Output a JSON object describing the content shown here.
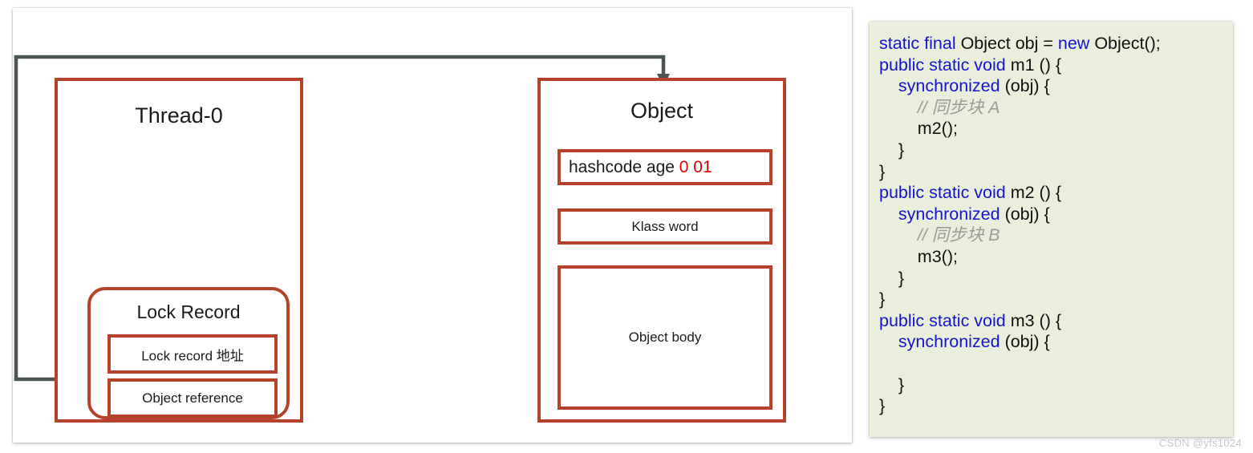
{
  "colors": {
    "brick_border": "#b5432a",
    "connector_gray": "#4c5456",
    "code_keyword_blue": "#1414d2",
    "code_comment_gray": "#9a9a9a",
    "markword_bits_red": "#e00000",
    "code_panel_background": "#eaeedc",
    "card_background": "#ffffff"
  },
  "diagram": {
    "thread": {
      "title": "Thread-0",
      "lock_record": {
        "title": "Lock Record",
        "rows": [
          {
            "label": "Lock record 地址"
          },
          {
            "label": "Object reference"
          }
        ]
      }
    },
    "object": {
      "title": "Object",
      "mark_word": {
        "label": "hashcode age",
        "bits": "0 01"
      },
      "klass_word": {
        "label": "Klass word"
      },
      "object_body": {
        "label": "Object body"
      }
    },
    "connector": {
      "name": "object-reference-to-object-arrow",
      "from": "Object reference",
      "to": "Object"
    }
  },
  "code_panel": {
    "lines": [
      [
        {
          "t": "static final ",
          "c": "kw"
        },
        {
          "t": "Object obj = ",
          "c": ""
        },
        {
          "t": "new ",
          "c": "kw"
        },
        {
          "t": "Object();",
          "c": ""
        }
      ],
      [
        {
          "t": "public static void ",
          "c": "kw"
        },
        {
          "t": "m1 () {",
          "c": ""
        }
      ],
      [
        {
          "t": "    ",
          "c": ""
        },
        {
          "t": "synchronized ",
          "c": "kw"
        },
        {
          "t": "(obj) {",
          "c": ""
        }
      ],
      [
        {
          "t": "        // 同步块 A",
          "c": "cmt"
        }
      ],
      [
        {
          "t": "        m2();",
          "c": ""
        }
      ],
      [
        {
          "t": "    }",
          "c": ""
        }
      ],
      [
        {
          "t": "}",
          "c": ""
        }
      ],
      [
        {
          "t": "public static void ",
          "c": "kw"
        },
        {
          "t": "m2 () {",
          "c": ""
        }
      ],
      [
        {
          "t": "    ",
          "c": ""
        },
        {
          "t": "synchronized ",
          "c": "kw"
        },
        {
          "t": "(obj) {",
          "c": ""
        }
      ],
      [
        {
          "t": "        // 同步块 B",
          "c": "cmt"
        }
      ],
      [
        {
          "t": "        m3();",
          "c": ""
        }
      ],
      [
        {
          "t": "    }",
          "c": ""
        }
      ],
      [
        {
          "t": "}",
          "c": ""
        }
      ],
      [
        {
          "t": "public static void ",
          "c": "kw"
        },
        {
          "t": "m3 () {",
          "c": ""
        }
      ],
      [
        {
          "t": "    ",
          "c": ""
        },
        {
          "t": "synchronized ",
          "c": "kw"
        },
        {
          "t": "(obj) {",
          "c": ""
        }
      ],
      [
        {
          "t": "",
          "c": ""
        }
      ],
      [
        {
          "t": "    }",
          "c": ""
        }
      ],
      [
        {
          "t": "}",
          "c": ""
        }
      ]
    ]
  },
  "watermark": {
    "text": "CSDN @yfs1024"
  }
}
